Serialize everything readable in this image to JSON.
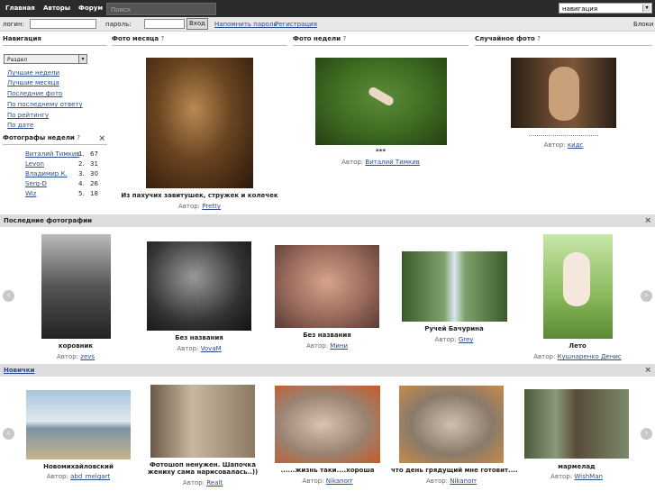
{
  "topnav": {
    "home": "Главная",
    "authors": "Авторы",
    "forum": "Форум",
    "search_placeholder": "Поиск",
    "nav_select": "навигация"
  },
  "login": {
    "login_label": "логин:",
    "password_label": "пароль:",
    "submit": "Вход",
    "remind": "Напомнить пароль",
    "register": "Регистрация",
    "blocks": "Блоки"
  },
  "sidebar": {
    "title": "Навигация",
    "section_select": "Раздел",
    "links": [
      "Лучшие недели",
      "Лучшие месяца",
      "Последние фото",
      "По последнему ответу",
      "По рейтингу",
      "По дате"
    ],
    "photographers_title": "Фотографы недели",
    "q": "?",
    "photographers": [
      {
        "name": "Виталий Тимкив",
        "rank": "1.",
        "score": "67"
      },
      {
        "name": "Levon",
        "rank": "2.",
        "score": "31"
      },
      {
        "name": "Владимир К.",
        "rank": "3.",
        "score": "30"
      },
      {
        "name": "Serg-D",
        "rank": "4.",
        "score": "26"
      },
      {
        "name": "Wiz",
        "rank": "5.",
        "score": "18"
      }
    ]
  },
  "photo_month": {
    "title": "Фото месяца",
    "q": "?",
    "caption": "Из пахучих завитушек, стружек и колечек",
    "author_label": "Автор:",
    "author": "Pretty"
  },
  "photo_week": {
    "title": "Фото недели",
    "q": "?",
    "caption": "***",
    "author_label": "Автор:",
    "author": "Виталий Тимкив"
  },
  "photo_random": {
    "title": "Случайное фото",
    "q": "?",
    "caption": "...................................",
    "author_label": "Автор:",
    "author": "кидс"
  },
  "recent": {
    "title": "Последние фотографии",
    "close": "×",
    "items": [
      {
        "caption": "коровник",
        "author": "zevs"
      },
      {
        "caption": "Без названия",
        "author": "VovaM"
      },
      {
        "caption": "Без названия",
        "author": "Мини"
      },
      {
        "caption": "Ручей Бачурина",
        "author": "Grey"
      },
      {
        "caption": "Лето",
        "author": "Кушнаренко Денис"
      }
    ]
  },
  "newbies": {
    "title": "Новички",
    "close": "×",
    "items": [
      {
        "caption": "Новомихайловский",
        "author": "abd_melgart"
      },
      {
        "caption": "Фотошоп ненужен. Шапочка",
        "caption2": "жениху сама нарисовалась..))",
        "author": "Realt"
      },
      {
        "caption": "......жизнь таки....хороша",
        "author": "Nikanorr"
      },
      {
        "caption": "что день грядущий мне готовит....",
        "author": "Nikanorr"
      },
      {
        "caption": "мармелад",
        "author": "WishMan"
      }
    ]
  },
  "author_label": "Автор:",
  "arrows": {
    "left": "‹",
    "right": "›"
  }
}
